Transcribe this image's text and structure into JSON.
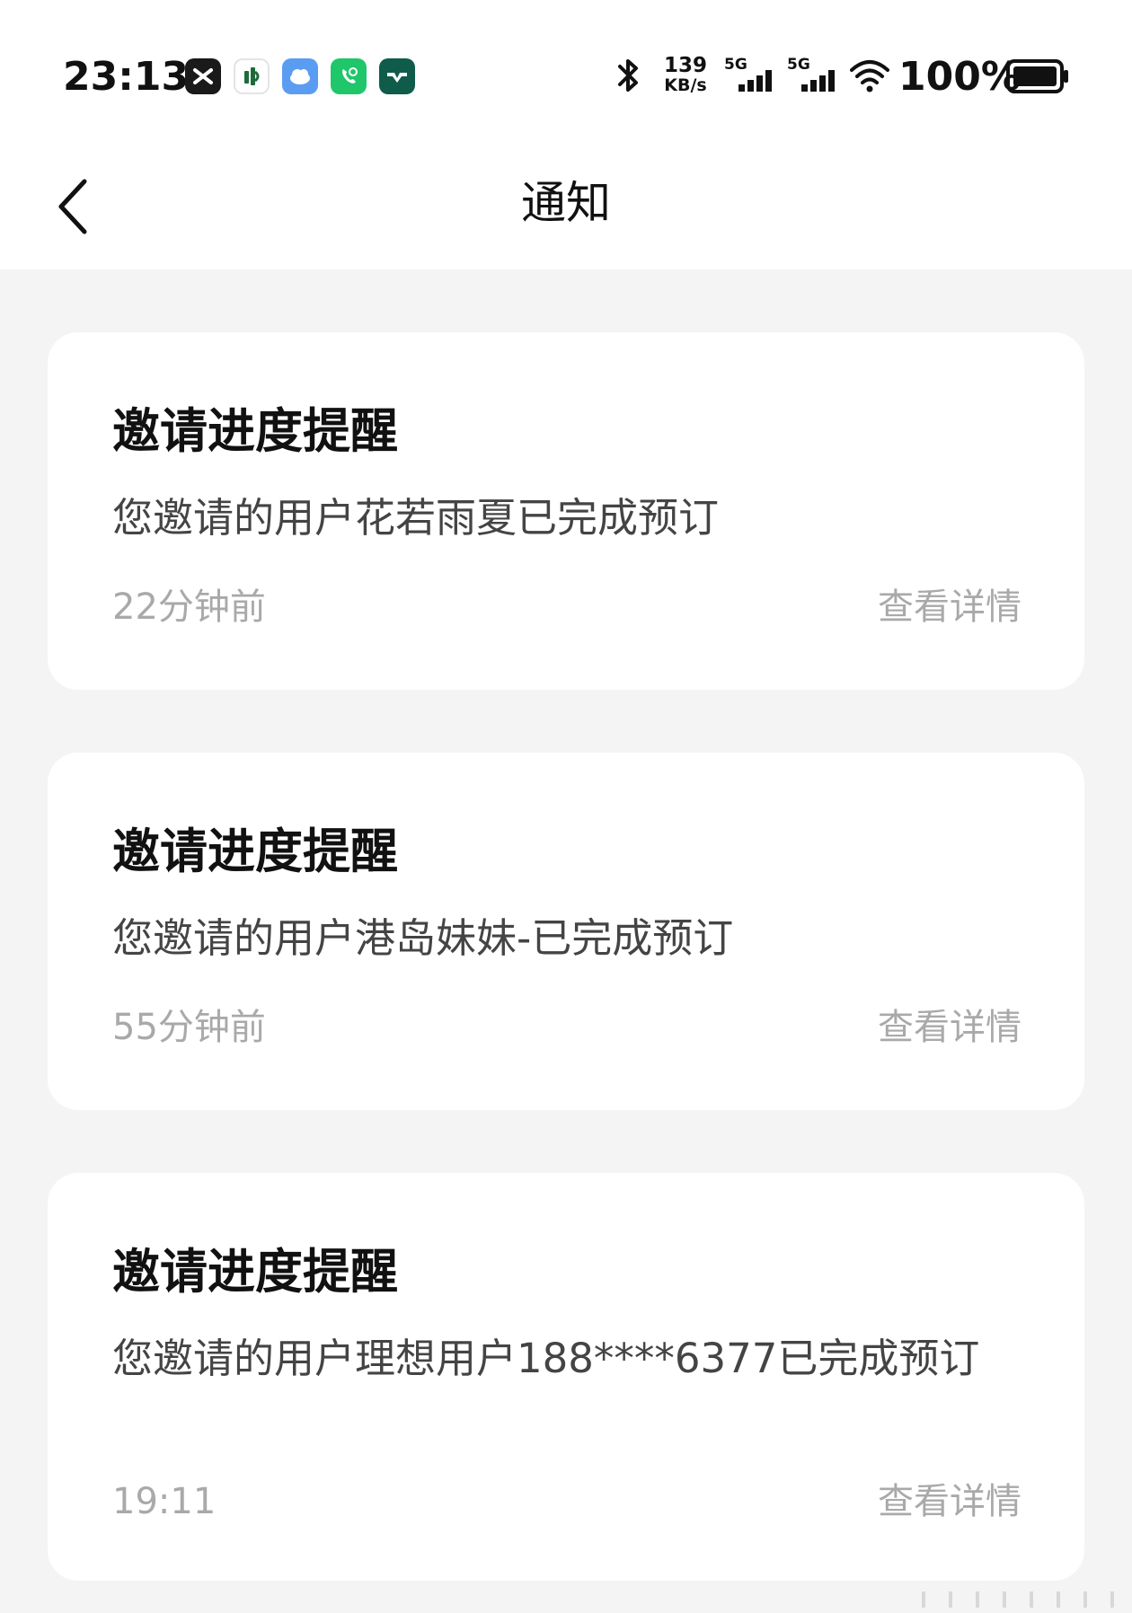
{
  "status_bar": {
    "time": "23:13",
    "network_speed_value": "139",
    "network_speed_unit": "KB/s",
    "signal_1_label": "5G",
    "signal_2_label": "5G",
    "battery_percent": "100%",
    "app_icons": [
      "capcut-icon",
      "stock-app-icon",
      "weather-icon",
      "phone-call-app-icon",
      "li-auto-app-icon"
    ],
    "system_icons": [
      "bluetooth-icon",
      "cell-signal-icon",
      "cell-signal-icon",
      "wifi-icon",
      "battery-icon"
    ]
  },
  "nav": {
    "title": "通知",
    "back_icon": "chevron-left-icon"
  },
  "notifications": [
    {
      "title": "邀请进度提醒",
      "body": "您邀请的用户花若雨夏已完成预订",
      "time": "22分钟前",
      "detail_label": "查看详情"
    },
    {
      "title": "邀请进度提醒",
      "body": "您邀请的用户港岛妹妹-已完成预订",
      "time": "55分钟前",
      "detail_label": "查看详情"
    },
    {
      "title": "邀请进度提醒",
      "body": "您邀请的用户理想用户188****6377已完成预订",
      "time": "19:11",
      "detail_label": "查看详情"
    }
  ],
  "colors": {
    "page_background": "#f4f4f4",
    "card_background": "#ffffff",
    "title_text": "#111111",
    "body_text": "#444444",
    "meta_text": "#a9a9a9"
  }
}
